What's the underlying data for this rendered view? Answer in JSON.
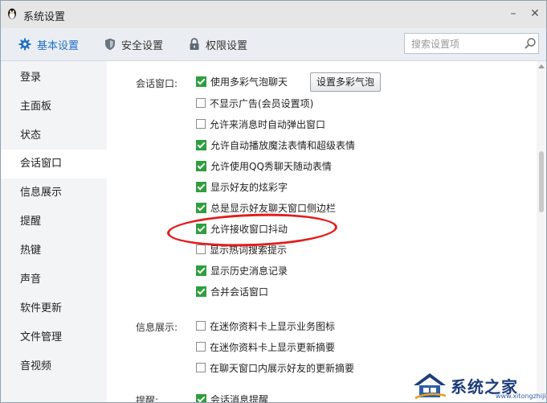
{
  "window": {
    "title": "系统设置",
    "minimize": "–",
    "close": "✕"
  },
  "tabs": [
    {
      "label": "基本设置",
      "icon": "gear-icon",
      "active": true
    },
    {
      "label": "安全设置",
      "icon": "shield-icon",
      "active": false
    },
    {
      "label": "权限设置",
      "icon": "lock-icon",
      "active": false
    }
  ],
  "search": {
    "placeholder": "搜索设置项",
    "value": ""
  },
  "sidebar": {
    "items": [
      {
        "label": "登录"
      },
      {
        "label": "主面板"
      },
      {
        "label": "状态"
      },
      {
        "label": "会话窗口",
        "active": true
      },
      {
        "label": "信息展示"
      },
      {
        "label": "提醒"
      },
      {
        "label": "热键"
      },
      {
        "label": "声音"
      },
      {
        "label": "软件更新"
      },
      {
        "label": "文件管理"
      },
      {
        "label": "音视频"
      }
    ]
  },
  "content": {
    "sections": [
      {
        "label": "会话窗口:",
        "button": "设置多彩气泡",
        "options": [
          {
            "label": "使用多彩气泡聊天",
            "checked": true
          },
          {
            "label": "不显示广告(会员设置项)",
            "checked": false
          },
          {
            "label": "允许来消息时自动弹出窗口",
            "checked": false
          },
          {
            "label": "允许自动播放魔法表情和超级表情",
            "checked": true
          },
          {
            "label": "允许使用QQ秀聊天随动表情",
            "checked": true
          },
          {
            "label": "显示好友的炫彩字",
            "checked": true
          },
          {
            "label": "总是显示好友聊天窗口侧边栏",
            "checked": true
          },
          {
            "label": "允许接收窗口抖动",
            "checked": true
          },
          {
            "label": "显示热词搜索提示",
            "checked": false
          },
          {
            "label": "显示历史消息记录",
            "checked": true
          },
          {
            "label": "合并会话窗口",
            "checked": true
          }
        ]
      },
      {
        "label": "信息展示:",
        "options": [
          {
            "label": "在迷你资料卡上显示业务图标",
            "checked": false
          },
          {
            "label": "在迷你资料卡上显示更新摘要",
            "checked": false
          },
          {
            "label": "在聊天窗口内展示好友的更新摘要",
            "checked": false
          }
        ]
      },
      {
        "label": "提醒:",
        "options": [
          {
            "label": "会话消息提醒",
            "checked": true
          }
        ]
      }
    ]
  },
  "annotation": {
    "color": "#e11d1d"
  },
  "watermark": {
    "text": "系统之家",
    "url": "www.xitongzhijia.net"
  },
  "colors": {
    "accent": "#1f6fc4",
    "check": "#2f9e3e"
  }
}
